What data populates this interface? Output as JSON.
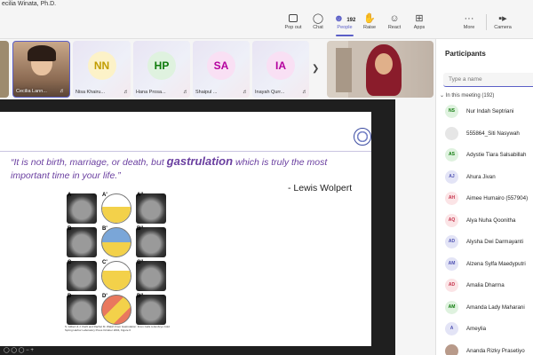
{
  "window": {
    "meeting_title": "ecilia Winata, Ph.D."
  },
  "toolbar": {
    "items": [
      {
        "label": "Pop out",
        "icon": "pop-out-icon"
      },
      {
        "label": "Chat",
        "icon": "chat-icon"
      },
      {
        "label": "People",
        "icon": "people-icon",
        "count": "192",
        "active": true
      },
      {
        "label": "Raise",
        "icon": "raise-hand-icon"
      },
      {
        "label": "React",
        "icon": "react-icon"
      },
      {
        "label": "Apps",
        "icon": "apps-icon"
      },
      {
        "label": "More",
        "icon": "more-icon"
      },
      {
        "label": "Camera",
        "icon": "camera-icon"
      }
    ],
    "accent": "#5b5fc7"
  },
  "video_strip": {
    "tiles": [
      {
        "name": "Cecilia Lann...",
        "type": "video"
      },
      {
        "name": "Nisa Khairu...",
        "initials": "NN",
        "type": "avatar",
        "color": "#c19c00"
      },
      {
        "name": "Hana Prosa...",
        "initials": "HP",
        "type": "avatar",
        "color": "#0e7a0b"
      },
      {
        "name": "Shaipul ...",
        "initials": "SA",
        "type": "avatar",
        "color": "#b4009e"
      },
      {
        "name": "Inayah Qurr...",
        "initials": "IA",
        "type": "avatar",
        "color": "#b4009e"
      },
      {
        "name": "",
        "type": "video"
      }
    ],
    "next_icon": "chevron-right-icon"
  },
  "slide": {
    "quote_pre": "“It is not birth, marriage, or death, but ",
    "quote_bold": "gastrulation",
    "quote_post": " which is truly the most important time in your life.”",
    "author": "- Lewis Wolpert",
    "figure_labels": [
      "A",
      "A'",
      "A''",
      "B",
      "B'",
      "B''",
      "C",
      "C'",
      "C''",
      "D",
      "D'",
      "D''"
    ],
    "figure_caption": "S. Gilbert & J. Kiehl and Rachel M. Walsh From Gastrulation: From Cells to Embryo Cold Spring Harbor Laboratory Press October 2004, Figure 6"
  },
  "participants": {
    "title": "Participants",
    "search_placeholder": "Type a name",
    "section_label": "In this meeting (192)",
    "people": [
      {
        "initials": "NS",
        "name": "Nur Indah Septriani",
        "color": "#0e7a0b",
        "bg": "#dff2df"
      },
      {
        "initials": "",
        "name": "555864_Siti Nasywah",
        "color": "#6a6a6a",
        "bg": "#e6e6e6"
      },
      {
        "initials": "AS",
        "name": "Adystie Tiara Salsabillah",
        "color": "#0e7a0b",
        "bg": "#dff2df"
      },
      {
        "initials": "AJ",
        "name": "Ahura Jivan",
        "color": "#4f52b2",
        "bg": "#e3e4f6"
      },
      {
        "initials": "AH",
        "name": "Aimee Humairo (557904)",
        "color": "#c4314b",
        "bg": "#fbe4e6"
      },
      {
        "initials": "AQ",
        "name": "Alya Nuha Qoonitha",
        "color": "#c4314b",
        "bg": "#fbe4e6"
      },
      {
        "initials": "AD",
        "name": "Alysha Dwi Darmayanti",
        "color": "#4f52b2",
        "bg": "#e3e4f6"
      },
      {
        "initials": "AM",
        "name": "Alzena Sylfa Maedyputri",
        "color": "#4f52b2",
        "bg": "#e3e4f6"
      },
      {
        "initials": "AD",
        "name": "Amalia Dharma",
        "color": "#c4314b",
        "bg": "#fbe4e6"
      },
      {
        "initials": "AM",
        "name": "Amanda Lady Maharani",
        "color": "#0e7a0b",
        "bg": "#dff2df"
      },
      {
        "initials": "A",
        "name": "Ameylia",
        "color": "#4f52b2",
        "bg": "#e3e4f6"
      },
      {
        "initials": "",
        "name": "Ananda Rizky Prasetiyo",
        "color": "#6a6a6a",
        "bg": "#b89a8a"
      }
    ]
  }
}
